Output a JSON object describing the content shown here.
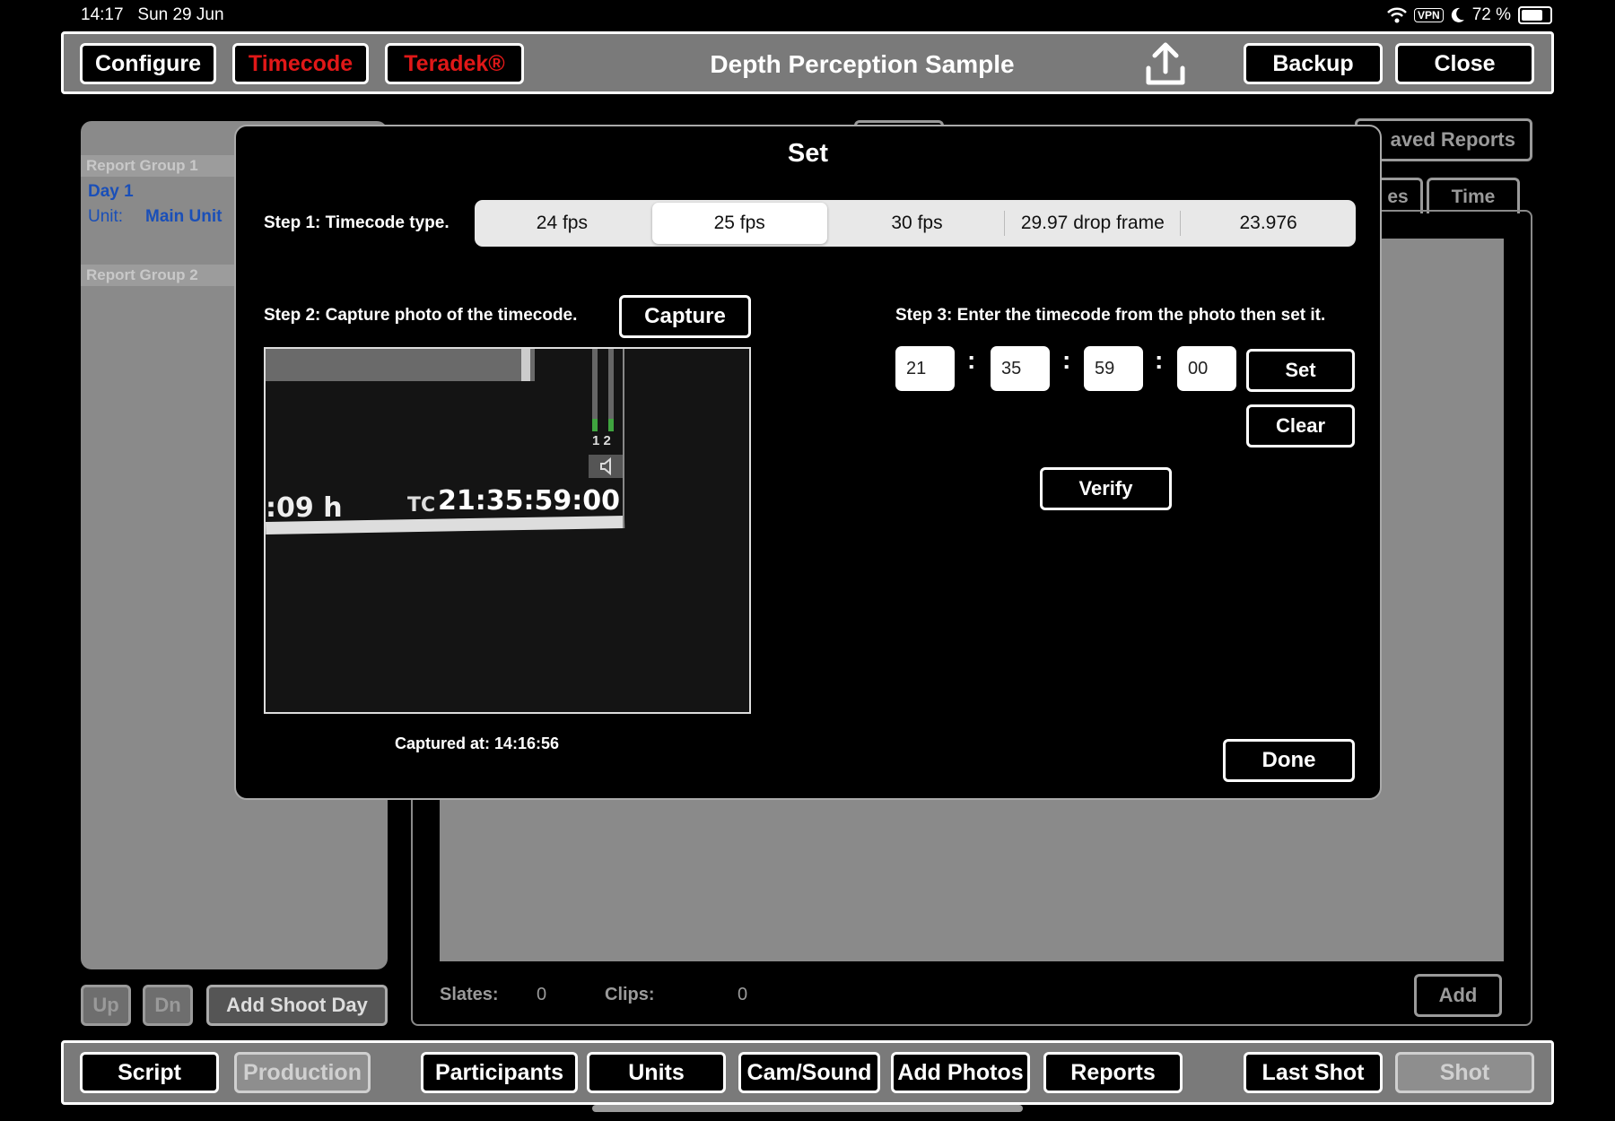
{
  "status": {
    "time": "14:17",
    "date": "Sun 29 Jun",
    "vpn": "VPN",
    "battery": "72 %",
    "battery_level": 0.72
  },
  "topbar": {
    "configure": "Configure",
    "timecode": "Timecode",
    "teradek": "Teradek®",
    "title": "Depth Perception Sample",
    "backup": "Backup",
    "close": "Close"
  },
  "sidebar": {
    "group1": "Report Group 1",
    "day1": "Day 1",
    "unit_label": "Unit:",
    "unit_value": "Main Unit",
    "group2": "Report Group 2",
    "up": "Up",
    "dn": "Dn",
    "add_shoot_day": "Add Shoot Day"
  },
  "main": {
    "saved_reports": "aved Reports",
    "tab_partial": "es",
    "tab_time": "Time",
    "slates_label": "Slates:",
    "slates_value": "0",
    "clips_label": "Clips:",
    "clips_value": "0",
    "add": "Add"
  },
  "modal": {
    "title": "Set",
    "step1": "Step 1: Timecode type.",
    "fps_options": [
      "24 fps",
      "25 fps",
      "30 fps",
      "29.97 drop frame",
      "23.976"
    ],
    "fps_selected": "25 fps",
    "step2": "Step 2: Capture photo of the timecode.",
    "capture": "Capture",
    "captured_at": "Captured at: 14:16:56",
    "step3": "Step 3: Enter the timecode from the photo then set it.",
    "tc_hours": "21",
    "tc_minutes": "35",
    "tc_seconds": "59",
    "tc_frames": "00",
    "set": "Set",
    "clear": "Clear",
    "verify": "Verify",
    "done": "Done",
    "photo": {
      "hours_text": ":09 h",
      "tc_prefix": "TC",
      "tc_value": "21:35:59:00",
      "channels": "1 2"
    }
  },
  "bottombar": {
    "script": "Script",
    "production": "Production",
    "participants": "Participants",
    "units": "Units",
    "cam_sound": "Cam/Sound",
    "add_photos": "Add Photos",
    "reports": "Reports",
    "last_shot": "Last Shot",
    "shot": "Shot"
  }
}
